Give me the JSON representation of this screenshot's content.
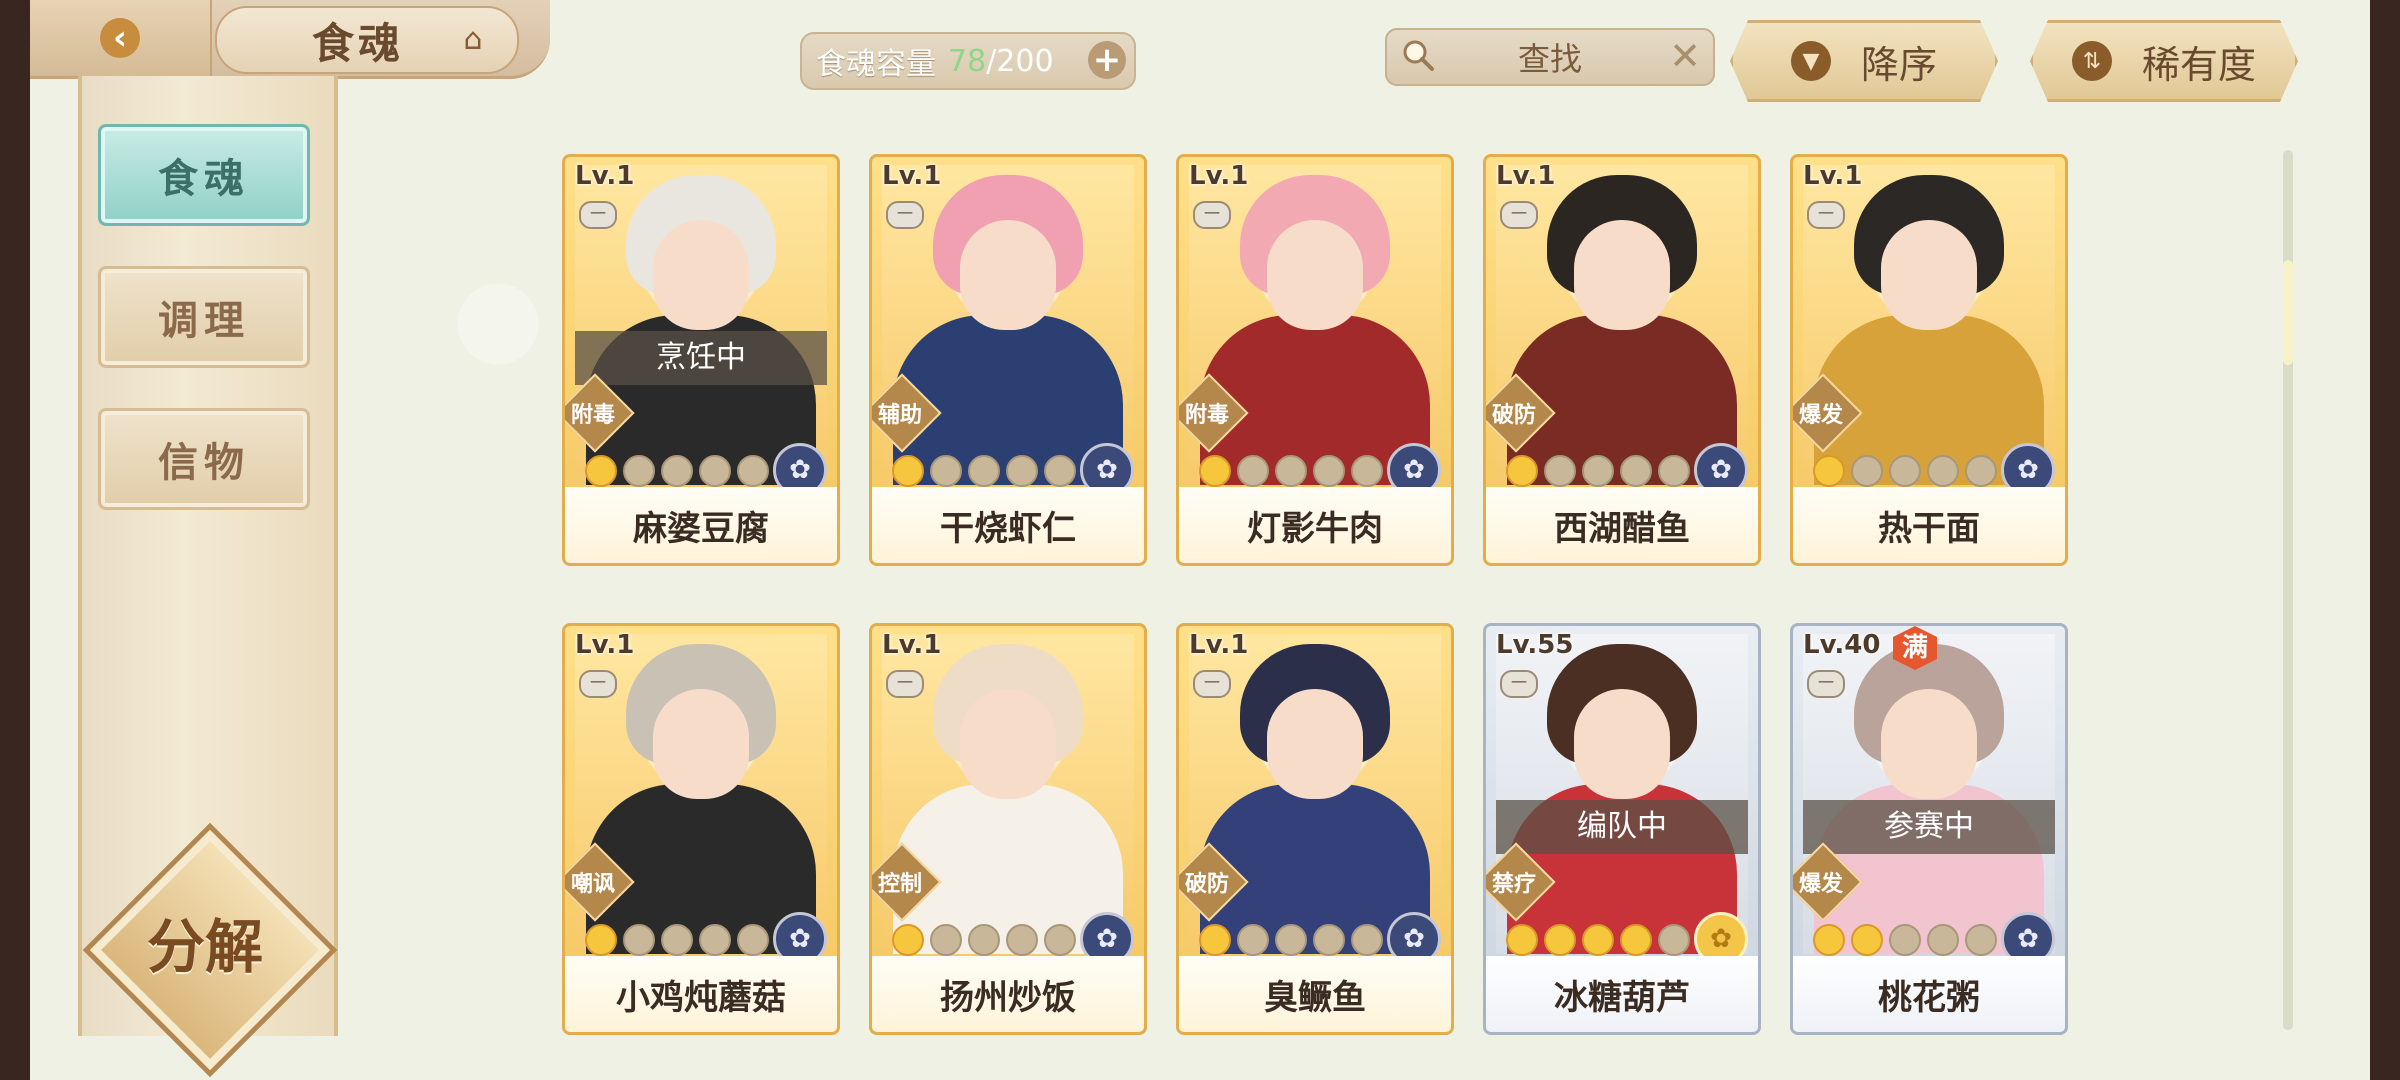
{
  "header": {
    "title": "食魂",
    "capacity": {
      "label": "食魂容量",
      "current": "78",
      "separator": "/",
      "max": "200",
      "add": "+"
    },
    "search": {
      "label": "查找",
      "clear": "✕"
    },
    "sort_order": {
      "label": "降序",
      "icon": "triangle-down-icon"
    },
    "sort_by": {
      "label": "稀有度",
      "icon": "sort-arrows-icon"
    }
  },
  "sidebar": {
    "tabs": [
      {
        "label": "食魂",
        "active": true
      },
      {
        "label": "调理",
        "active": false
      },
      {
        "label": "信物",
        "active": false
      }
    ],
    "decompose_label": "分解"
  },
  "cards": [
    {
      "level": "Lv.1",
      "name": "麻婆豆腐",
      "role": "附毒",
      "status": "烹饪中",
      "stars": 1,
      "emblem": "✿",
      "colors": {
        "hair": "#e9e6e0",
        "body": "#2a2a2a"
      }
    },
    {
      "level": "Lv.1",
      "name": "干烧虾仁",
      "role": "辅助",
      "status": "",
      "stars": 1,
      "emblem": "✿",
      "colors": {
        "hair": "#f1a0b2",
        "body": "#2c3f72"
      }
    },
    {
      "level": "Lv.1",
      "name": "灯影牛肉",
      "role": "附毒",
      "status": "",
      "stars": 1,
      "emblem": "✿",
      "colors": {
        "hair": "#f2a9b2",
        "body": "#a32a2a"
      }
    },
    {
      "level": "Lv.1",
      "name": "西湖醋鱼",
      "role": "破防",
      "status": "",
      "stars": 1,
      "emblem": "✿",
      "colors": {
        "hair": "#2b2622",
        "body": "#7a2c24"
      }
    },
    {
      "level": "Lv.1",
      "name": "热干面",
      "role": "爆发",
      "status": "",
      "stars": 1,
      "emblem": "✿",
      "colors": {
        "hair": "#2b2826",
        "body": "#d8a23a"
      }
    },
    {
      "level": "Lv.1",
      "name": "小鸡炖蘑菇",
      "role": "嘲讽",
      "status": "",
      "stars": 1,
      "emblem": "✿",
      "colors": {
        "hair": "#c9c2b4",
        "body": "#2a2a2a"
      }
    },
    {
      "level": "Lv.1",
      "name": "扬州炒饭",
      "role": "控制",
      "status": "",
      "stars": 1,
      "emblem": "✿",
      "colors": {
        "hair": "#efdcc6",
        "body": "#f5f0e8"
      }
    },
    {
      "level": "Lv.1",
      "name": "臭鳜鱼",
      "role": "破防",
      "status": "",
      "stars": 1,
      "emblem": "✿",
      "colors": {
        "hair": "#2b2f4a",
        "body": "#33407a"
      }
    },
    {
      "level": "Lv.55",
      "name": "冰糖葫芦",
      "role": "禁疗",
      "status": "编队中",
      "stars": 4,
      "emblem": "✿",
      "emblem_gold": true,
      "silver": true,
      "colors": {
        "hair": "#4a2f22",
        "body": "#c8333a"
      }
    },
    {
      "level": "Lv.40",
      "name": "桃花粥",
      "role": "爆发",
      "status": "参赛中",
      "stars": 2,
      "emblem": "✿",
      "silver": true,
      "max": "满",
      "colors": {
        "hair": "#b9a39a",
        "body": "#f2c4d0"
      }
    }
  ]
}
